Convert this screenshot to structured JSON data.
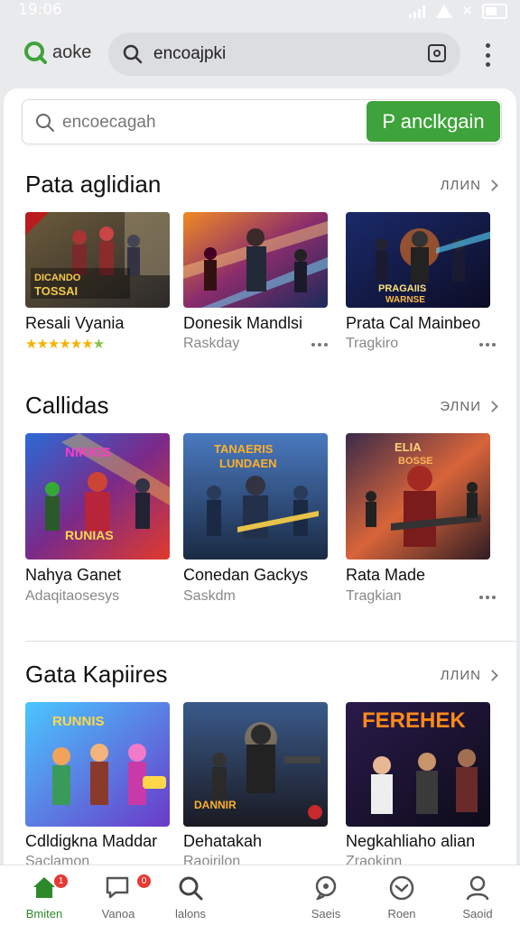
{
  "status_bar": {
    "time": "19:06"
  },
  "topbar": {
    "brand": "aoke",
    "address_text": "encoajpki"
  },
  "search": {
    "placeholder": "encoecagah",
    "button_label": "P anclkgain"
  },
  "colors": {
    "accent": "#3ea33a",
    "badge": "#e53935"
  },
  "sections": [
    {
      "title": "Pata aglidian",
      "more_label": "ЛЛИN",
      "games": [
        {
          "title": "Resali Vyania",
          "rating": "★★★★★★",
          "rating_extra": "★",
          "thumb_text": "DICANDO\nTOSSAI"
        },
        {
          "title": "Donesik Mandlsi",
          "subtitle": "Raskday"
        },
        {
          "title": "Prata Cal Mainbeo",
          "subtitle": "Tragkiro",
          "thumb_text": "PRAGAIIS\nWARNSE"
        }
      ]
    },
    {
      "title": "Callidas",
      "more_label": "ЭЛNИ",
      "games": [
        {
          "title": "Nahya Ganet",
          "subtitle": "Adaqitaosesys",
          "thumb_text": "NIKKIS\nRUNIAS"
        },
        {
          "title": "Conedan Gackys",
          "subtitle": "Saskdm",
          "thumb_text": "TANAERIS\nLUNDAEN"
        },
        {
          "title": "Rata Made",
          "subtitle": "Tragkian",
          "thumb_text": "ELIA\nBOSSE"
        }
      ]
    },
    {
      "title": "Gata Kapiires",
      "more_label": "ЛЛИN",
      "games": [
        {
          "title": "Cdldigkna Maddar",
          "subtitle": "Saclamon",
          "thumb_text": "RUNNIS"
        },
        {
          "title": "Dehatakah",
          "subtitle": "Raoirilon",
          "thumb_text": "DANNIR"
        },
        {
          "title": "Negkahliaho alian",
          "subtitle": "Zraokinn",
          "thumb_text": "FEREHEK"
        }
      ]
    }
  ],
  "bottom_nav": [
    {
      "label": "Bmiten",
      "icon": "home-icon",
      "badge": "1"
    },
    {
      "label": "Vanoa",
      "icon": "chat-icon",
      "badge": "0"
    },
    {
      "label": "lalons",
      "icon": "search-icon"
    },
    {
      "label": "Saeis",
      "icon": "message-icon"
    },
    {
      "label": "Roen",
      "icon": "clock-icon"
    },
    {
      "label": "Saoid",
      "icon": "profile-icon"
    }
  ]
}
